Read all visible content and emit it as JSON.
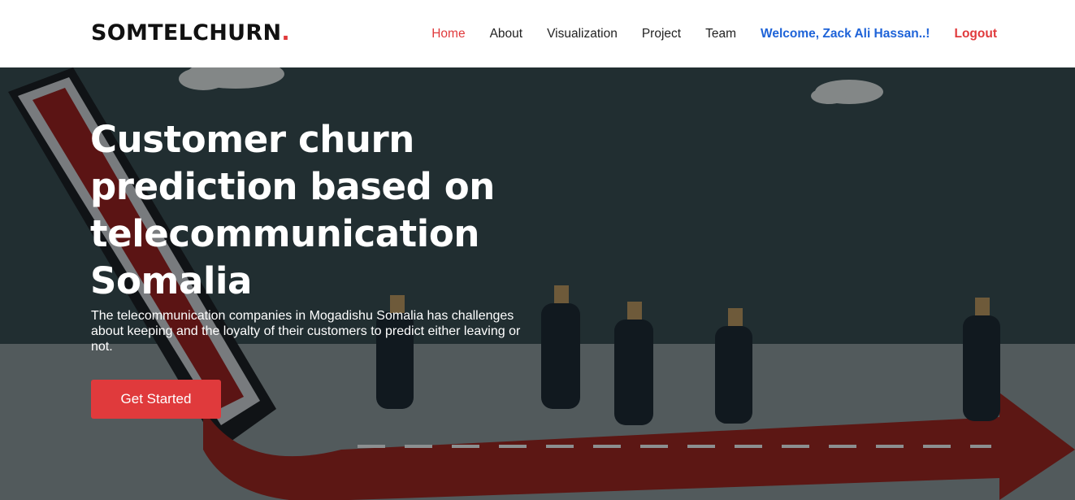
{
  "brand": {
    "name": "SOMTELCHURN",
    "dot": ".",
    "accent": "#e03a3c"
  },
  "nav": {
    "home": "Home",
    "about": "About",
    "visualization": "Visualization",
    "project": "Project",
    "team": "Team",
    "welcome": "Welcome, Zack Ali Hassan..!",
    "logout": "Logout"
  },
  "hero": {
    "title": "Customer churn prediction based on telecommunication Somalia",
    "subtitle": "The telecommunication companies in Mogadishu Somalia has challenges about keeping and the loyalty of their customers to predict either leaving or not.",
    "cta_label": "Get Started",
    "background_image": "businessmen-running-on-red-arrow-illustration"
  },
  "colors": {
    "link_active": "#e03a3c",
    "welcome": "#1e63d8",
    "button": "#e03a3c"
  }
}
